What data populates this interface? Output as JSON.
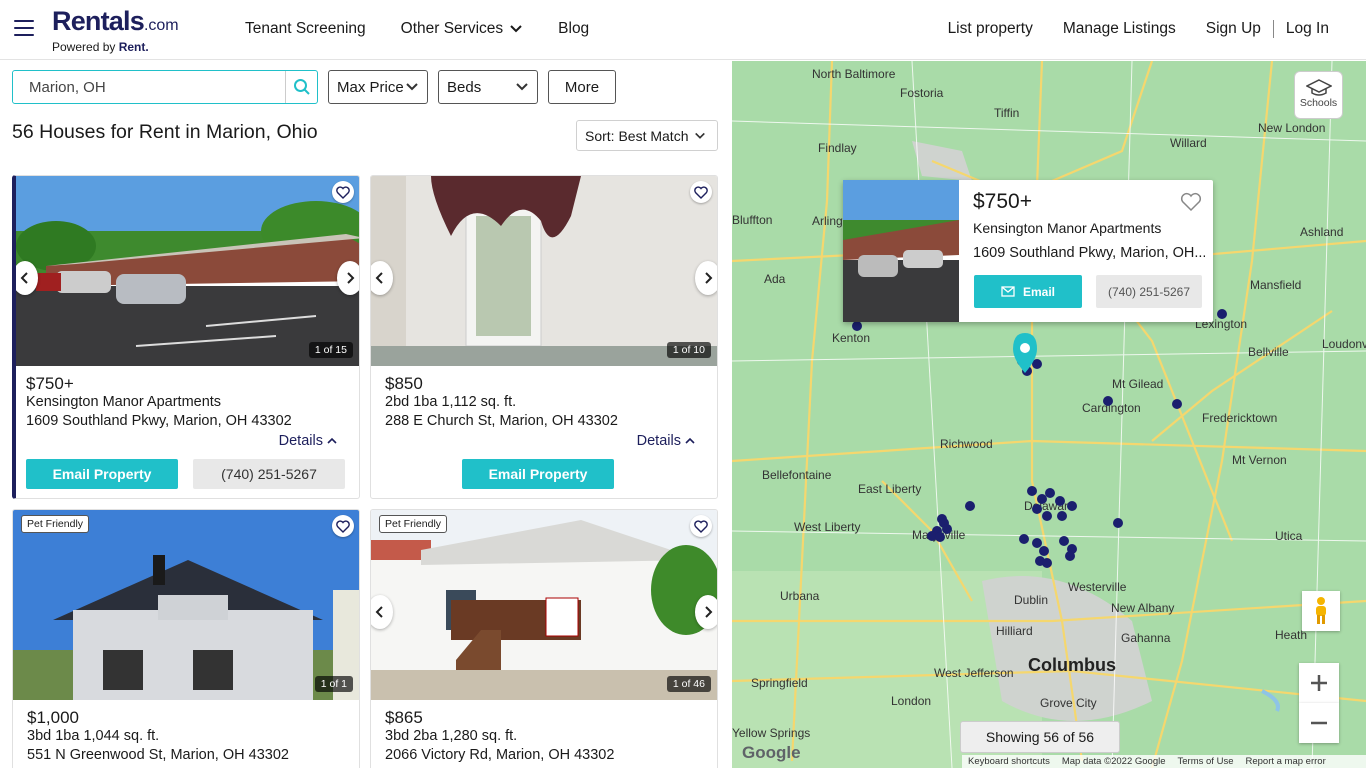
{
  "header": {
    "logo_main": "Rentals",
    "logo_suffix": ".com",
    "logo_sub_prefix": "Powered by ",
    "logo_sub_brand": "Rent.",
    "nav_left": [
      "Tenant Screening",
      "Other Services",
      "Blog"
    ],
    "nav_right": [
      "List property",
      "Manage Listings",
      "Sign Up",
      "Log In"
    ]
  },
  "search": {
    "value": "Marion, OH"
  },
  "filters": {
    "max_price": "Max Price",
    "beds": "Beds",
    "more": "More"
  },
  "results_title": "56 Houses for Rent in Marion, Ohio",
  "sort_label": "Sort: Best Match",
  "details_label": "Details",
  "email_property_label": "Email Property",
  "pet_badge": "Pet Friendly",
  "listings": [
    {
      "price": "$750+",
      "name": "Kensington Manor Apartments",
      "address": "1609 Southland Pkwy, Marion, OH 43302",
      "count": "1 of 15",
      "phone": "(740) 251-5267"
    },
    {
      "price": "$850",
      "specs": "2bd  1ba 1,112 sq. ft.",
      "address": "288 E Church St, Marion, OH 43302",
      "count": "1 of 10"
    },
    {
      "price": "$1,000",
      "specs": "3bd  1ba 1,044 sq. ft.",
      "address": "551 N Greenwood St, Marion, OH 43302",
      "count": "1 of 1"
    },
    {
      "price": "$865",
      "specs": "3bd  2ba 1,280 sq. ft.",
      "address": "2066 Victory Rd, Marion, OH 43302",
      "count": "1 of 46"
    }
  ],
  "map": {
    "schools_label": "Schools",
    "showing": "Showing 56 of 56",
    "popup": {
      "price": "$750+",
      "name": "Kensington Manor Apartments",
      "address": "1609 Southland Pkwy, Marion, OH...",
      "email": "Email",
      "phone": "(740) 251-5267"
    },
    "labels": [
      "North Baltimore",
      "Fostoria",
      "Tiffin",
      "New London",
      "Findlay",
      "Willard",
      "Bluffton",
      "Arlington",
      "Ashland",
      "Ada",
      "Mansfield",
      "Lexington",
      "Kenton",
      "Bellville",
      "Loudonville",
      "Mt Gilead",
      "Cardington",
      "Fredericktown",
      "Richwood",
      "Bellefontaine",
      "Mt Vernon",
      "East Liberty",
      "West Liberty",
      "Delaware",
      "Marysville",
      "Utica",
      "Westerville",
      "Urbana",
      "Dublin",
      "New Albany",
      "Hilliard",
      "Gahanna",
      "Columbus",
      "Heath",
      "West Jefferson",
      "Springfield",
      "London",
      "Grove City",
      "Yellow Springs"
    ],
    "footer": [
      "Keyboard shortcuts",
      "Map data ©2022 Google",
      "Terms of Use",
      "Report a map error"
    ],
    "google": "Google"
  },
  "colors": {
    "brand": "#1d1f5c",
    "accent": "#20c0c9"
  }
}
